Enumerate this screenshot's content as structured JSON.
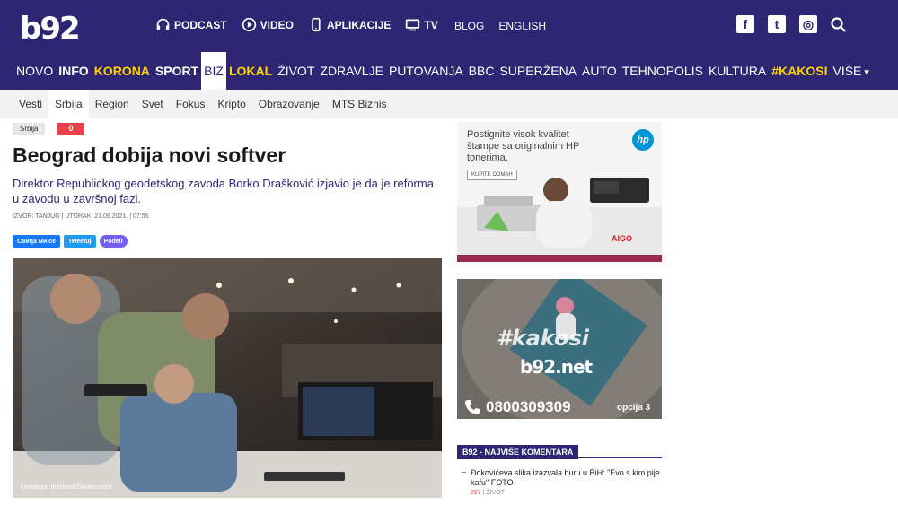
{
  "header": {
    "logo": "b92",
    "top_nav": [
      {
        "label": "PODCAST",
        "icon": "headphones-icon"
      },
      {
        "label": "VIDEO",
        "icon": "play-icon"
      },
      {
        "label": "APLIKACIJE",
        "icon": "phone-icon"
      },
      {
        "label": "TV",
        "icon": "tv-icon"
      }
    ],
    "top_right": [
      "BLOG",
      "ENGLISH"
    ],
    "social": [
      {
        "name": "facebook-icon",
        "glyph": "f"
      },
      {
        "name": "twitter-icon",
        "glyph": "t"
      },
      {
        "name": "instagram-icon",
        "glyph": "◎"
      }
    ],
    "colors": {
      "brand": "#2e2673",
      "highlight": "#ffd400",
      "accent_red": "#e8424a"
    }
  },
  "main_nav": [
    {
      "label": "NOVO",
      "style": "normal"
    },
    {
      "label": "INFO",
      "style": "bold"
    },
    {
      "label": "KORONA",
      "style": "yellow"
    },
    {
      "label": "SPORT",
      "style": "bold"
    },
    {
      "label": "BIZ",
      "style": "active"
    },
    {
      "label": "LOKAL",
      "style": "yellow"
    },
    {
      "label": "ŽIVOT",
      "style": "normal"
    },
    {
      "label": "ZDRAVLJE",
      "style": "normal"
    },
    {
      "label": "PUTOVANJA",
      "style": "normal"
    },
    {
      "label": "BBC",
      "style": "normal"
    },
    {
      "label": "SUPERŽENA",
      "style": "normal"
    },
    {
      "label": "AUTO",
      "style": "normal"
    },
    {
      "label": "TEHNOPOLIS",
      "style": "normal"
    },
    {
      "label": "KULTURA",
      "style": "normal"
    },
    {
      "label": "#KAKOSI",
      "style": "yellow"
    },
    {
      "label": "VIŠE",
      "style": "more"
    }
  ],
  "sub_nav": [
    {
      "label": "Vesti",
      "active": false
    },
    {
      "label": "Srbija",
      "active": true
    },
    {
      "label": "Region",
      "active": false
    },
    {
      "label": "Svet",
      "active": false
    },
    {
      "label": "Fokus",
      "active": false
    },
    {
      "label": "Kripto",
      "active": false
    },
    {
      "label": "Obrazovanje",
      "active": false
    },
    {
      "label": "MTS Biznis",
      "active": false
    }
  ],
  "article": {
    "category_tag": "Srbija",
    "comment_count": "0",
    "title": "Beograd dobija novi softver",
    "lead": "Direktor Republickog geodetskog zavoda Borko Drašković izjavio je da je reforma u zavodu u završnoj fazi.",
    "meta": "IZVOR: TANJUG | UTORAK, 21.09.2021. | 07:55",
    "share": {
      "facebook": "Свиђа ми се",
      "twitter": "Tweetuj",
      "viber": "Podeli"
    },
    "photo_caption": "Ilustracija: dotshock/Shutterstock"
  },
  "ads": {
    "hp": {
      "text": "Postignite visok kvalitet štampe sa originalnim HP tonerima.",
      "cta": "KUPITE ODMAH",
      "logo": "hp",
      "partner": "AIGO"
    },
    "kakosi": {
      "hashtag": "#kakosi",
      "site": "b92.net",
      "phone": "0800309309",
      "option": "opcija 3"
    }
  },
  "sidebar_widget": {
    "title": "B92 - NAJVIŠE KOMENTARA",
    "items": [
      {
        "title": "Đokovićeva slika izazvala buru u BiH: \"Evo s kim pije kafu\" FOTO",
        "count": "207",
        "section": "ŽIVOT"
      }
    ]
  }
}
